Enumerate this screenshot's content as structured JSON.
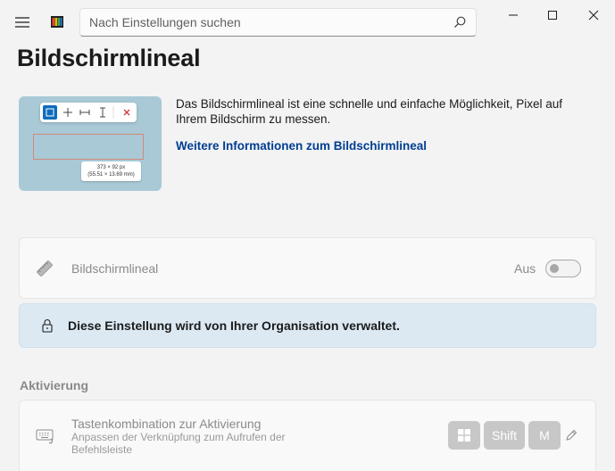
{
  "titlebar": {
    "search_placeholder": "Nach Einstellungen suchen",
    "icons": [
      "hamburger-icon",
      "app-logo-icon",
      "search-icon",
      "minimize-icon",
      "maximize-icon",
      "close-icon"
    ]
  },
  "page": {
    "title": "Bildschirmlineal",
    "description": "Das Bildschirmlineal ist eine schnelle und einfache Möglichkeit, Pixel auf Ihrem Bildschirm zu messen.",
    "learn_more": "Weitere Informationen zum Bildschirmlineal",
    "preview": {
      "size_line1": "373 × 92 px",
      "size_line2": "(55.51 × 13.69 mm)"
    }
  },
  "ruler_setting": {
    "label": "Bildschirmlineal",
    "state": "Aus",
    "enabled": false
  },
  "banner": {
    "text": "Diese Einstellung wird von Ihrer Organisation verwaltet."
  },
  "activation": {
    "section_title": "Aktivierung",
    "shortcut_title": "Tastenkombination zur Aktivierung",
    "shortcut_description": "Anpassen der Verknüpfung zum Aufrufen der Befehlsleiste",
    "keys": {
      "shift": "Shift",
      "m": "M"
    }
  },
  "colors": {
    "background": "#f3f3f3",
    "accent_link": "#003e92",
    "banner_bg": "#dce9f3",
    "disabled_text": "#8a8a8a",
    "key_bg": "#c7c7c7"
  }
}
